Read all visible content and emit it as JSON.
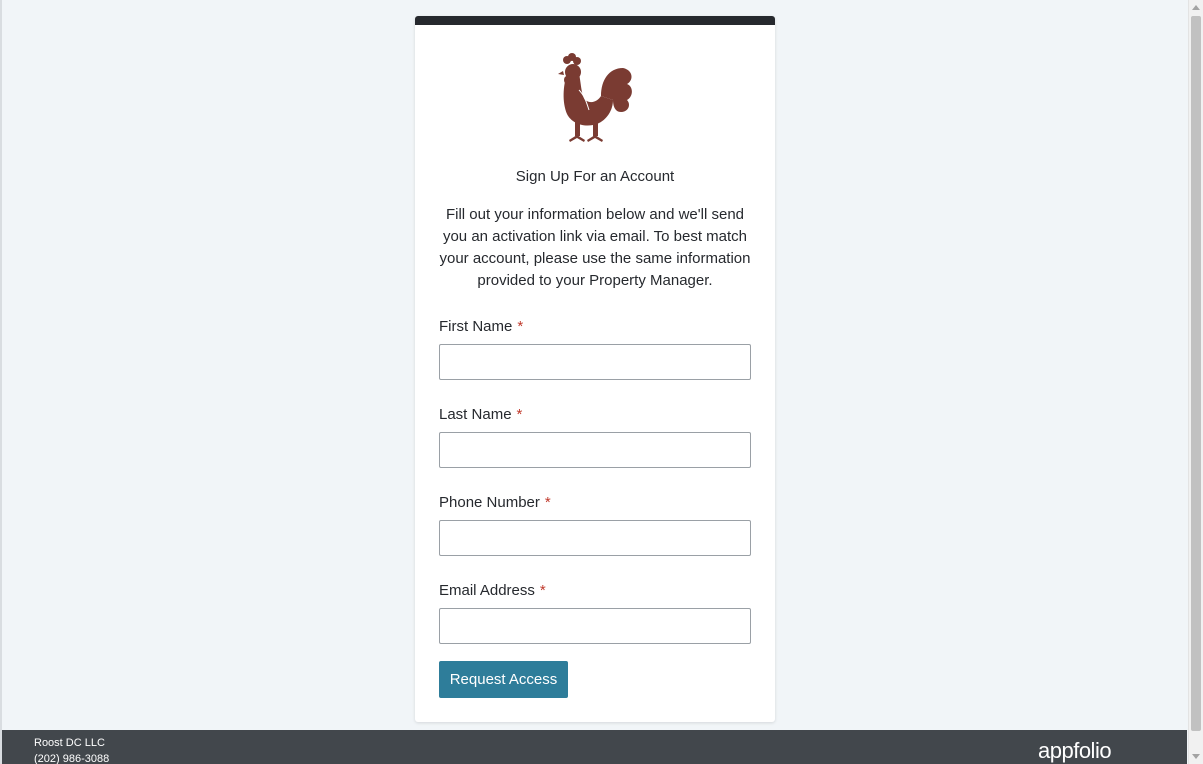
{
  "form": {
    "title": "Sign Up For an Account",
    "intro": "Fill out your information below and we'll send you an activation link via email. To best match your account, please use the same information provided to your Property Manager.",
    "required_marker": "*",
    "fields": [
      {
        "label": "First Name",
        "value": "",
        "placeholder": ""
      },
      {
        "label": "Last Name",
        "value": "",
        "placeholder": ""
      },
      {
        "label": "Phone Number",
        "value": "",
        "placeholder": ""
      },
      {
        "label": "Email Address",
        "value": "",
        "placeholder": ""
      }
    ],
    "submit_label": "Request Access"
  },
  "logo": {
    "icon": "rooster-icon",
    "color": "#7a3b32"
  },
  "footer": {
    "company": "Roost DC LLC",
    "phone": "(202) 986-3088",
    "brand": "appfolio"
  },
  "colors": {
    "accent_button": "#2e7d9a",
    "card_top_bar": "#26292e",
    "footer_bg": "#42474c",
    "page_bg": "#f1f5f8",
    "required": "#c0392b"
  }
}
